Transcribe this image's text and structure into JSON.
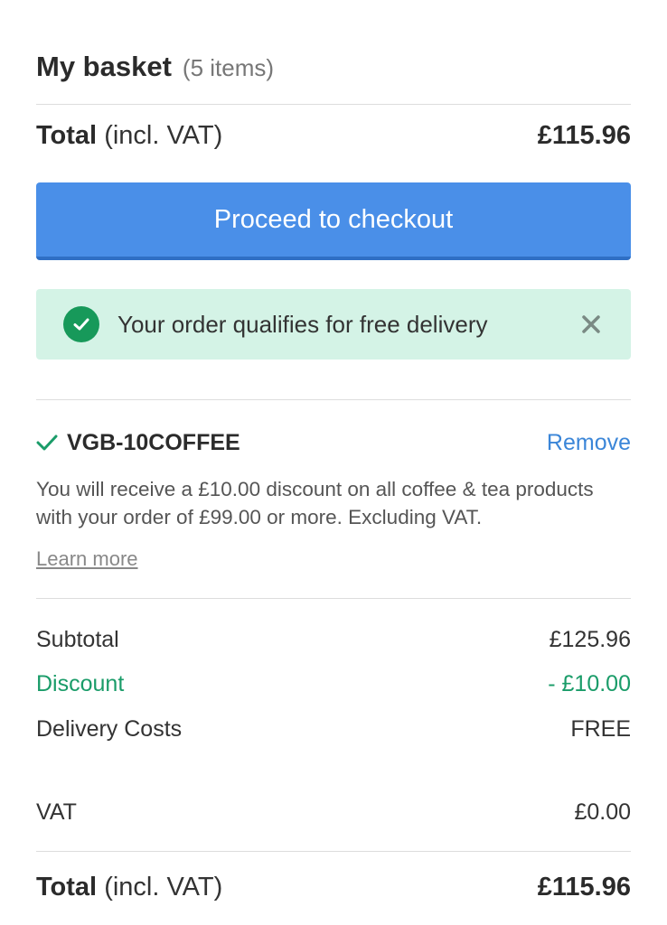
{
  "header": {
    "title": "My basket",
    "item_count": "(5 items)"
  },
  "total_top": {
    "label_bold": "Total",
    "label_rest": "(incl. VAT)",
    "value": "£115.96"
  },
  "checkout": {
    "label": "Proceed to checkout",
    "color": "#4a8fe8"
  },
  "notice": {
    "text": "Your order qualifies for free delivery",
    "icon": "check-circle-icon",
    "close_icon": "close-icon",
    "background": "#d4f3e6"
  },
  "coupon": {
    "code": "VGB-10COFFEE",
    "remove_label": "Remove",
    "description": "You will receive a £10.00 discount on all coffee & tea products with your order of £99.00 or more. Excluding VAT.",
    "learn_more": "Learn more"
  },
  "summary": {
    "subtotal_label": "Subtotal",
    "subtotal_value": "£125.96",
    "discount_label": "Discount",
    "discount_value": "- £10.00",
    "delivery_label": "Delivery Costs",
    "delivery_value": "FREE",
    "vat_label": "VAT",
    "vat_value": "£0.00"
  },
  "total_bottom": {
    "label_bold": "Total",
    "label_rest": "(incl. VAT)",
    "value": "£115.96"
  },
  "colors": {
    "accent_green": "#1a9c69",
    "link_blue": "#3b86d8"
  }
}
